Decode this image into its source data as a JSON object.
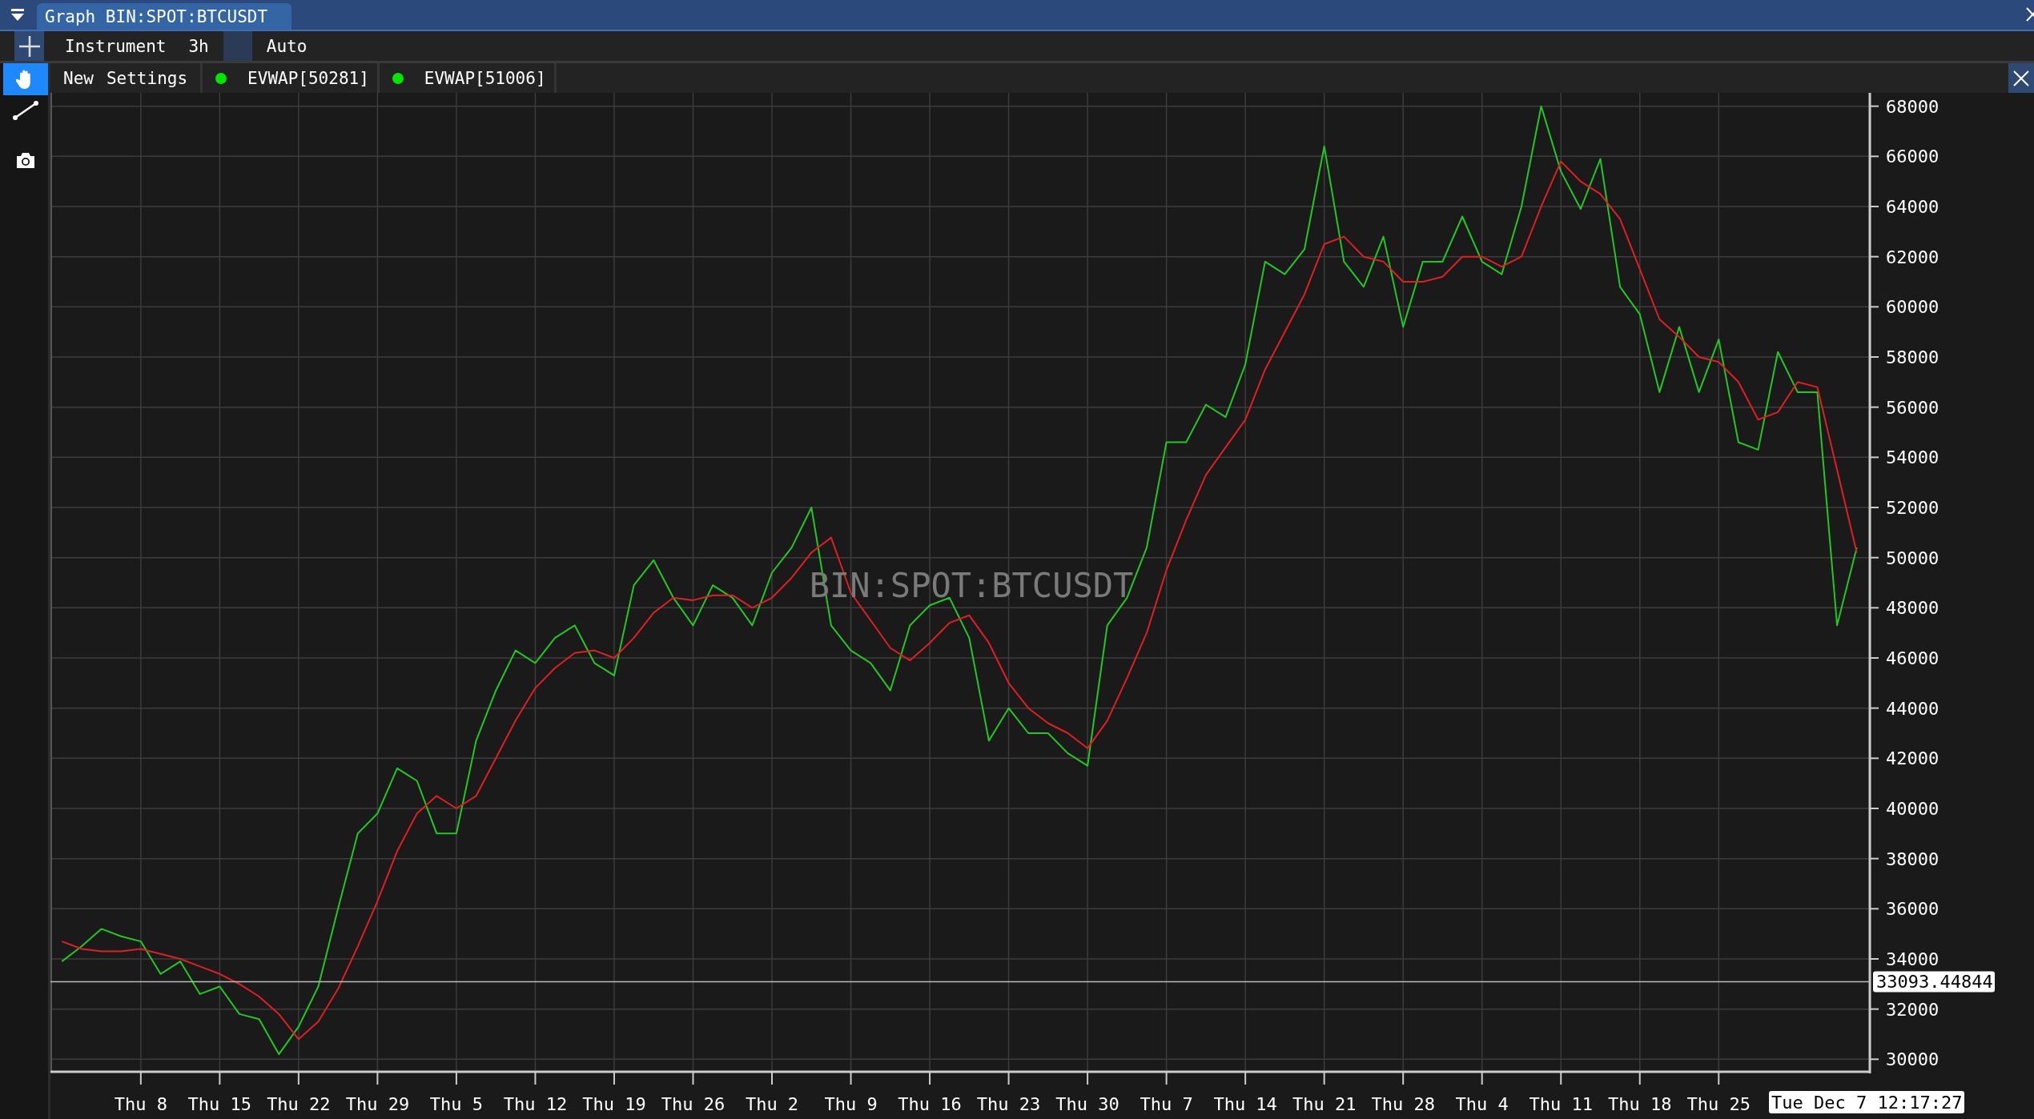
{
  "window": {
    "title": "Graph BIN:SPOT:BTCUSDT"
  },
  "toolbar": {
    "items": [
      {
        "kind": "label",
        "text": "Instrument"
      },
      {
        "kind": "label",
        "text": "3h"
      },
      {
        "kind": "swatch"
      },
      {
        "kind": "label",
        "text": "Auto"
      }
    ]
  },
  "tools": [
    {
      "kind": "pan",
      "selected": true
    },
    {
      "kind": "line",
      "selected": false
    },
    {
      "kind": "snapshot",
      "selected": false
    }
  ],
  "legend": {
    "menu": [
      "New",
      "Settings"
    ],
    "items": [
      {
        "on": true
      },
      {
        "on": true
      }
    ]
  },
  "chart": {
    "watermark": "BIN:SPOT:BTCUSDT",
    "crosshair_time": "Tue Dec 7 12:17:27",
    "chart_data": {
      "type": "line",
      "grid": true,
      "ylim": [
        29500,
        68500
      ],
      "ref_lines": [
        {
          "axis": "y",
          "value": 33093.44844,
          "label": "33093.44844"
        }
      ],
      "categories": [
        null,
        null,
        null,
        null,
        "Thu 8",
        null,
        null,
        null,
        "Thu 15",
        null,
        null,
        null,
        "Thu 22",
        null,
        null,
        null,
        "Thu 29",
        null,
        null,
        null,
        "Thu 5",
        null,
        null,
        null,
        "Thu 12",
        null,
        null,
        null,
        "Thu 19",
        null,
        null,
        null,
        "Thu 26",
        null,
        null,
        null,
        "Thu 2",
        null,
        null,
        null,
        "Thu 9",
        null,
        null,
        null,
        "Thu 16",
        null,
        null,
        null,
        "Thu 23",
        null,
        null,
        null,
        "Thu 30",
        null,
        null,
        null,
        "Thu 7",
        null,
        null,
        null,
        "Thu 14",
        null,
        null,
        null,
        "Thu 21",
        null,
        null,
        null,
        "Thu 28",
        null,
        null,
        null,
        "Thu 4",
        null,
        null,
        null,
        "Thu 11",
        null,
        null,
        null,
        "Thu 18",
        null,
        null,
        null,
        "Thu 25",
        null,
        null,
        null,
        null,
        null,
        null,
        null
      ],
      "yticks": [
        30000,
        32000,
        34000,
        36000,
        38000,
        40000,
        42000,
        44000,
        46000,
        48000,
        50000,
        52000,
        54000,
        56000,
        58000,
        60000,
        62000,
        64000,
        66000,
        68000
      ],
      "series": [
        {
          "name": "EVWAP[50281]",
          "color": "#22c822",
          "values": [
            33900,
            34500,
            35200,
            34900,
            34700,
            33400,
            33900,
            32600,
            32900,
            31800,
            31600,
            30200,
            31300,
            32900,
            36000,
            39000,
            39800,
            41600,
            41100,
            39000,
            39000,
            42700,
            44700,
            46300,
            45800,
            46800,
            47300,
            45800,
            45300,
            48900,
            49900,
            48400,
            47300,
            48900,
            48400,
            47300,
            49400,
            50400,
            52000,
            47300,
            46300,
            45800,
            44700,
            47300,
            48100,
            48400,
            46800,
            42700,
            44000,
            43000,
            43000,
            42200,
            41700,
            47300,
            48400,
            50400,
            54600,
            54600,
            56100,
            55600,
            57700,
            61800,
            61300,
            62300,
            66400,
            61800,
            60800,
            62800,
            59200,
            61800,
            61800,
            63600,
            61800,
            61300,
            64000,
            68000,
            65400,
            63900,
            65900,
            60800,
            59700,
            56600,
            59200,
            56600,
            58700,
            54600,
            54300,
            58200,
            56600,
            56600,
            47300,
            50400
          ]
        },
        {
          "name": "EVWAP[51006]",
          "color": "#e02020",
          "values": [
            34700,
            34400,
            34300,
            34300,
            34400,
            34200,
            34000,
            33700,
            33400,
            33000,
            32500,
            31800,
            30800,
            31500,
            32800,
            34500,
            36300,
            38300,
            39800,
            40500,
            40000,
            40500,
            42000,
            43500,
            44800,
            45600,
            46200,
            46300,
            46000,
            46800,
            47800,
            48400,
            48300,
            48500,
            48500,
            48000,
            48400,
            49200,
            50200,
            50800,
            48600,
            47500,
            46400,
            45900,
            46600,
            47400,
            47700,
            46600,
            45000,
            44000,
            43400,
            43000,
            42400,
            43500,
            45200,
            47000,
            49500,
            51500,
            53300,
            54400,
            55500,
            57500,
            59000,
            60500,
            62500,
            62800,
            62000,
            61800,
            61000,
            61000,
            61200,
            62000,
            62000,
            61600,
            62000,
            64000,
            65800,
            65000,
            64500,
            63500,
            61500,
            59500,
            58800,
            58000,
            57800,
            57000,
            55500,
            55800,
            57000,
            56800,
            53500,
            50200
          ]
        }
      ]
    }
  }
}
